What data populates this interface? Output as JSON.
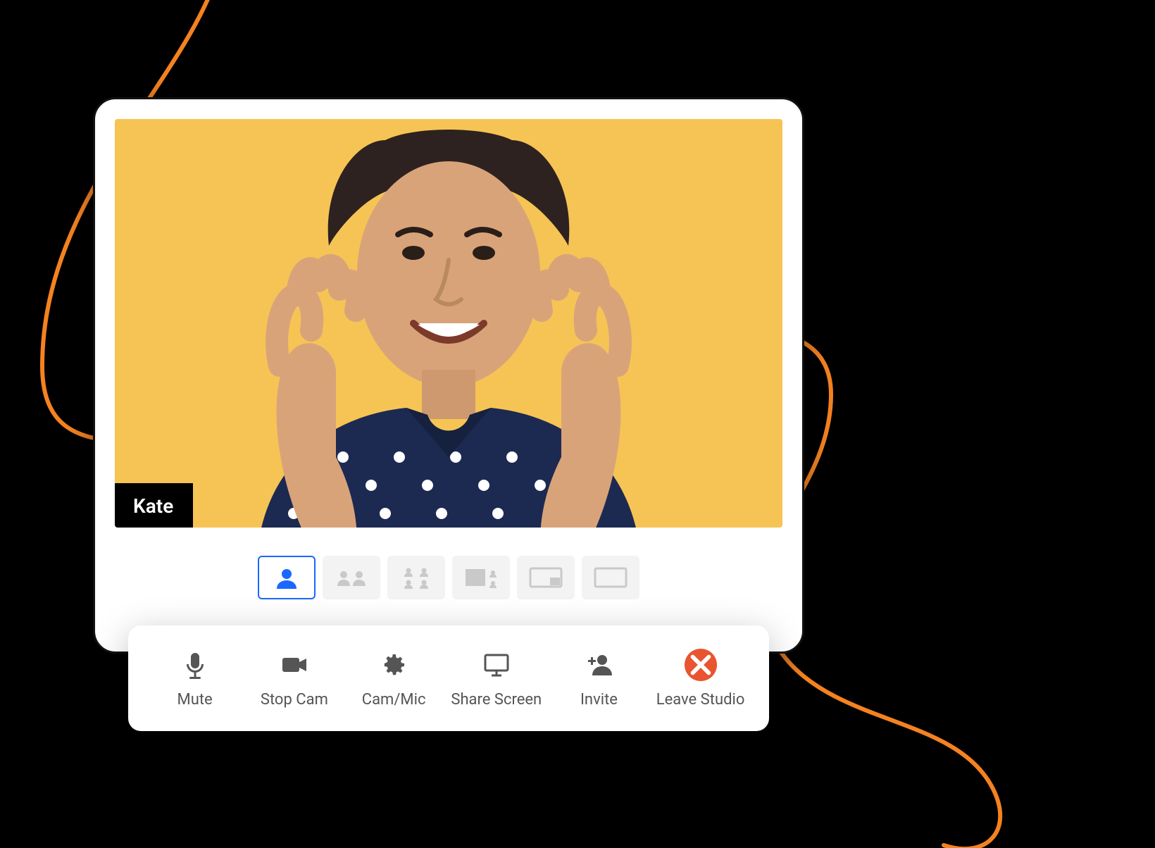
{
  "participant": {
    "name": "Kate"
  },
  "layouts": {
    "options": [
      "solo",
      "two-up",
      "four-up",
      "three-side",
      "pip",
      "blank"
    ],
    "active_index": 0
  },
  "toolbar": {
    "mute": "Mute",
    "stop_cam": "Stop Cam",
    "cam_mic": "Cam/Mic",
    "share_screen": "Share Screen",
    "invite": "Invite",
    "leave": "Leave Studio"
  },
  "colors": {
    "accent": "#1968ff",
    "video_bg": "#f6c454",
    "leave": "#e8552f",
    "swirl": "#f58220"
  }
}
